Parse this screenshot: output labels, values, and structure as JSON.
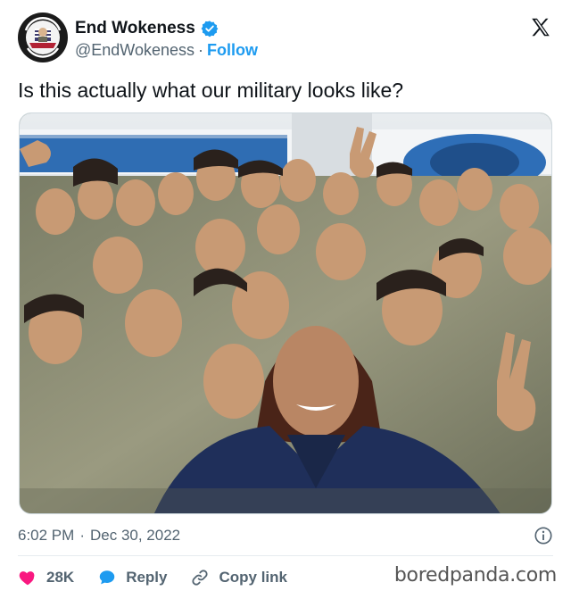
{
  "author": {
    "display_name": "End Wokeness",
    "handle": "@EndWokeness",
    "separator": "·",
    "follow_label": "Follow",
    "avatar_text": "SUPPORT THE TROOPS · GOLDEN THINGS"
  },
  "tweet": {
    "text": "Is this actually what our military looks like?"
  },
  "meta": {
    "time": "6:02 PM",
    "separator": "·",
    "date": "Dec 30, 2022"
  },
  "actions": {
    "likes": "28K",
    "reply_label": "Reply",
    "copy_label": "Copy link"
  },
  "watermark": "boredpanda.com",
  "colors": {
    "accent": "#1d9bf0",
    "like": "#f91880",
    "text_primary": "#0f1419",
    "text_secondary": "#536471"
  },
  "icons": {
    "verified": "verified-badge-icon",
    "x_logo": "x-logo-icon",
    "info": "info-icon",
    "like": "heart-icon",
    "reply": "reply-bubble-icon",
    "copy": "link-icon"
  }
}
